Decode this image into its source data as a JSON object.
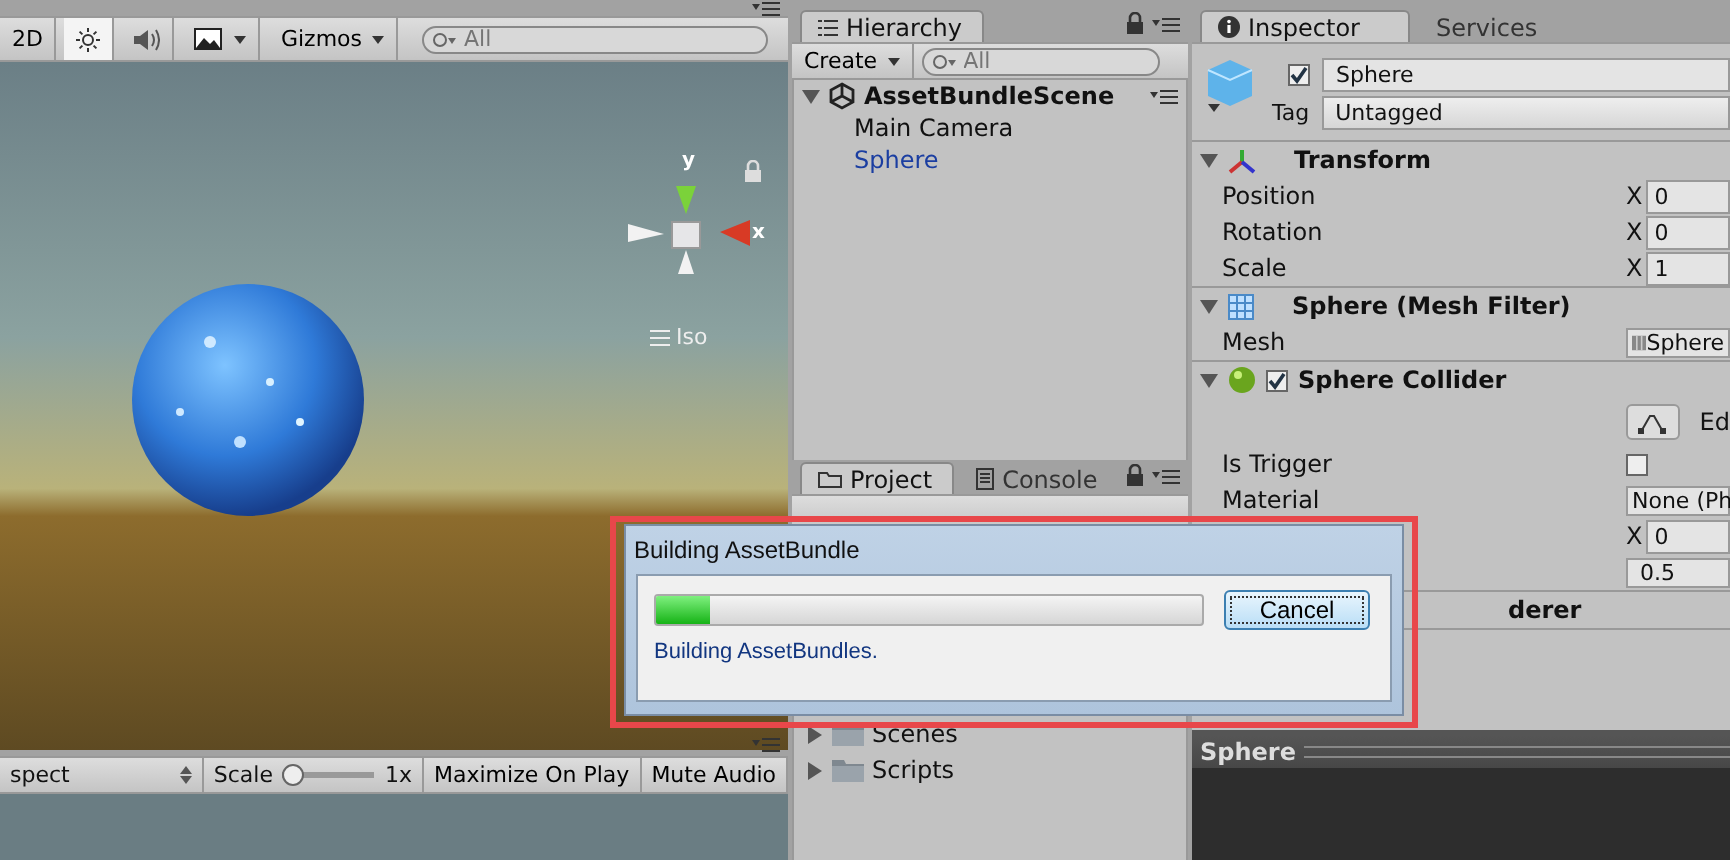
{
  "scene_toolbar": {
    "mode_button": "2D",
    "gizmos": "Gizmos",
    "search_placeholder": "All"
  },
  "scene_view": {
    "gizmo_axes": [
      "y",
      "x"
    ],
    "projection": "Iso"
  },
  "game_toolbar": {
    "aspect": "spect",
    "scale_label": "Scale",
    "scale": {
      "level": 0
    },
    "scale_value": "1x",
    "buttons": [
      {
        "label": "Maximize On Play",
        "on": false
      },
      {
        "label": "Mute Audio",
        "on": false
      }
    ]
  },
  "hierarchy": {
    "tab": "Hierarchy",
    "create": "Create",
    "search_placeholder": "All",
    "scene": "AssetBundleScene",
    "items": [
      {
        "label": "Main Camera",
        "selected": false
      },
      {
        "label": "Sphere",
        "selected": true
      }
    ]
  },
  "project": {
    "tabs": [
      {
        "label": "Project",
        "selected": true
      },
      {
        "label": "Console",
        "selected": false
      }
    ],
    "folders": [
      {
        "label": "Scenes",
        "expanded": false
      },
      {
        "label": "Scripts",
        "expanded": false
      }
    ]
  },
  "inspector": {
    "tabs": [
      {
        "label": "Inspector",
        "selected": true
      },
      {
        "label": "Services",
        "selected": false
      }
    ],
    "object": {
      "name": "Sphere",
      "active": true,
      "tag_label": "Tag",
      "tag": "Untagged"
    },
    "components": [
      {
        "kind": "transform",
        "title": "Transform",
        "rows": [
          {
            "kind": "vector",
            "label": "Position",
            "axis": "X",
            "value": "0"
          },
          {
            "kind": "vector",
            "label": "Rotation",
            "axis": "X",
            "value": "0"
          },
          {
            "kind": "vector",
            "label": "Scale",
            "axis": "X",
            "value": "1"
          }
        ]
      },
      {
        "kind": "mesh",
        "title": "Sphere (Mesh Filter)",
        "rows": [
          {
            "kind": "object",
            "label": "Mesh",
            "value": "Sphere"
          }
        ]
      },
      {
        "kind": "collider",
        "title": "Sphere Collider",
        "enabled": true,
        "rows": [
          {
            "kind": "button",
            "value": "Ed"
          },
          {
            "kind": "checkbox",
            "label": "Is Trigger",
            "checked": false
          },
          {
            "kind": "object",
            "label": "Material",
            "value": "None (Ph"
          },
          {
            "kind": "vector",
            "axis": "X",
            "value": "0"
          },
          {
            "kind": "number",
            "value": "0.5"
          }
        ]
      },
      {
        "kind": "renderer",
        "title": "derer"
      }
    ],
    "preview_title": "Sphere"
  },
  "dialog": {
    "title": "Building AssetBundle",
    "level": 0.1,
    "status": "Building AssetBundles.",
    "button": "Cancel"
  }
}
